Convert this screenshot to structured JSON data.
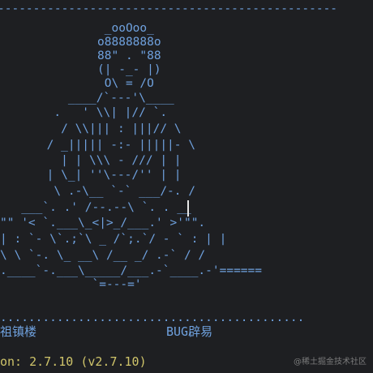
{
  "terminal": {
    "top_rule": "------------------------------------------------",
    "art_lines": [
      "            _ooOoo_",
      "           o8888888o",
      "           88\" . \"88",
      "           (| -_- |)",
      "            O\\ = /O",
      "        ____/`---'\\____",
      "      .   ' \\\\| |// `.",
      "       / \\\\||| : |||// \\",
      "     / _||||| -:- |||||- \\",
      "       | | \\\\\\ - /// | |",
      "     | \\_| ''\\---/'' | |",
      "      \\ .-\\__ `-` ___/-. /",
      "   ___`. .' /--.--\\ `. . __",
      "\"\" '< `.___\\_<|>_/___.' >'\"\".",
      "| : `- \\`.;`\\ _ /`;.`/ - ` : | |",
      "\\ \\ `-. \\_ __\\ /__ _/ .-` / /",
      ".____`-.___\\_____/___.-`____.-'======",
      "             `=---='"
    ],
    "dotted_rule": "...........................................",
    "footer_left": "祖镇楼",
    "footer_right": "BUG辟易",
    "version_line": "on: 2.7.10 (v2.7.10)",
    "watermark": "@稀土掘金技术社区"
  },
  "colors": {
    "background": "#1e1f22",
    "art": "#6fa1de",
    "version": "#cfc46a",
    "cursor": "#e6e6e6"
  }
}
